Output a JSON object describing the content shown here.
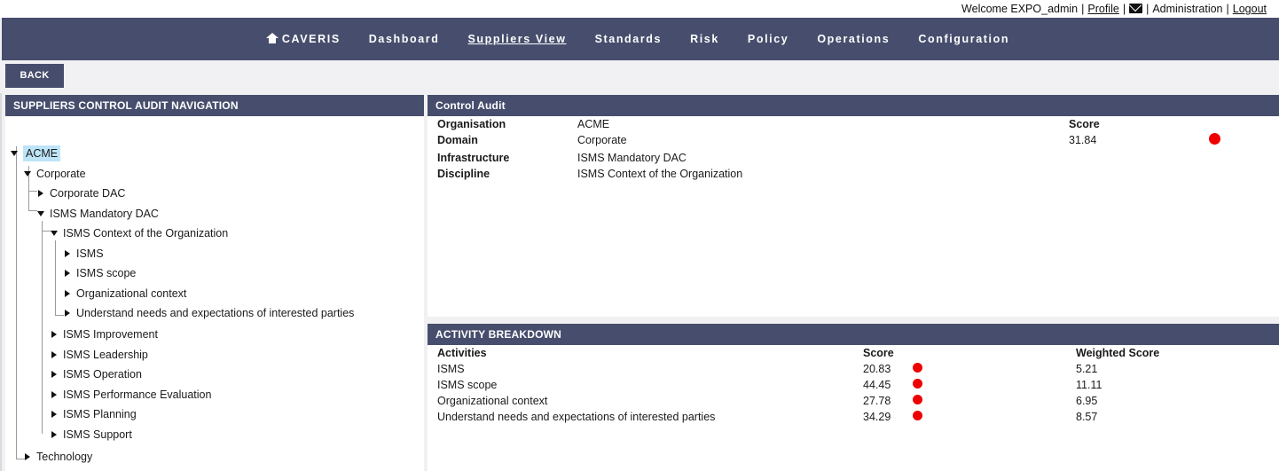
{
  "userbar": {
    "welcome": "Welcome EXPO_admin",
    "profile": "Profile",
    "separator": "|",
    "mail_icon": "envelope-icon",
    "administration": "Administration",
    "logout": "Logout"
  },
  "nav": {
    "home_icon": "home-icon",
    "brand": "CAVERIS",
    "items": [
      "Dashboard",
      "Suppliers View",
      "Standards",
      "Risk",
      "Policy",
      "Operations",
      "Configuration"
    ],
    "active": "Suppliers View"
  },
  "back_label": "BACK",
  "left_panel": {
    "title": "SUPPLIERS CONTROL AUDIT NAVIGATION",
    "tree": {
      "root": "ACME",
      "corporate": "Corporate",
      "corporate_dac": "Corporate DAC",
      "isms_mandatory_dac": "ISMS Mandatory DAC",
      "isms_context": "ISMS Context of the Organization",
      "context_children": [
        "ISMS",
        "ISMS scope",
        "Organizational context",
        "Understand needs and expectations of interested parties"
      ],
      "mandatory_children": [
        "ISMS Improvement",
        "ISMS Leadership",
        "ISMS Operation",
        "ISMS Performance Evaluation",
        "ISMS Planning",
        "ISMS Support"
      ],
      "technology": "Technology"
    }
  },
  "control_audit": {
    "title": "Control Audit",
    "organisation_label": "Organisation",
    "organisation": "ACME",
    "domain_label": "Domain",
    "domain": "Corporate",
    "infrastructure_label": "Infrastructure",
    "infrastructure": "ISMS Mandatory DAC",
    "discipline_label": "Discipline",
    "discipline": "ISMS Context of the Organization",
    "score_label": "Score",
    "score": "31.84",
    "status_color": "#ee0000"
  },
  "activity_breakdown": {
    "title": "ACTIVITY BREAKDOWN",
    "headers": {
      "activities": "Activities",
      "score": "Score",
      "weighted": "Weighted Score"
    },
    "rows": [
      {
        "activity": "ISMS",
        "score": "20.83",
        "weighted": "5.21"
      },
      {
        "activity": "ISMS scope",
        "score": "44.45",
        "weighted": "11.11"
      },
      {
        "activity": "Organizational context",
        "score": "27.78",
        "weighted": "6.95"
      },
      {
        "activity": "Understand needs and expectations of interested parties",
        "score": "34.29",
        "weighted": "8.57"
      }
    ]
  }
}
